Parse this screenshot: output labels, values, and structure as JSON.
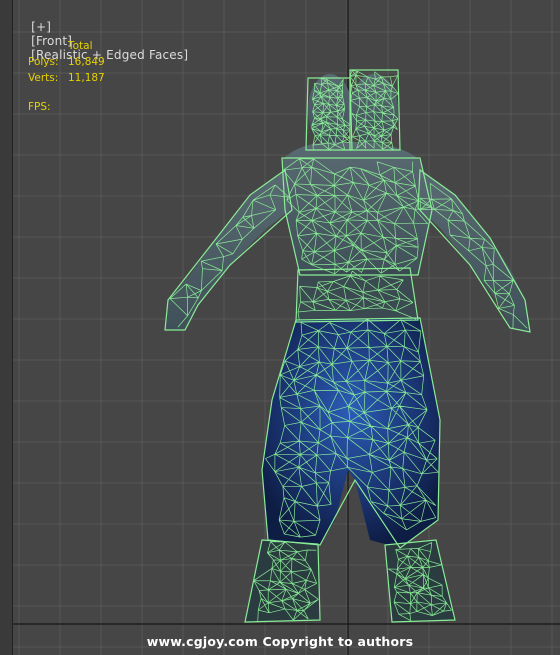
{
  "viewport_label": {
    "plus": "[+]",
    "view": "[Front]",
    "shading": "[Realistic + Edged Faces]"
  },
  "stats": {
    "header": "Total",
    "polys_label": "Polys:",
    "polys_value": "16,849",
    "verts_label": "Verts:",
    "verts_value": "11,187",
    "fps_label": "FPS:"
  },
  "watermark": "www.cgjoy.com Copyright to authors",
  "colors": {
    "background": "#464646",
    "grid": "#575757",
    "axis": "#1e1e1e",
    "stats_text": "#e6d200",
    "wire": "#8ef59a",
    "shaded": "#1b3a7a"
  }
}
